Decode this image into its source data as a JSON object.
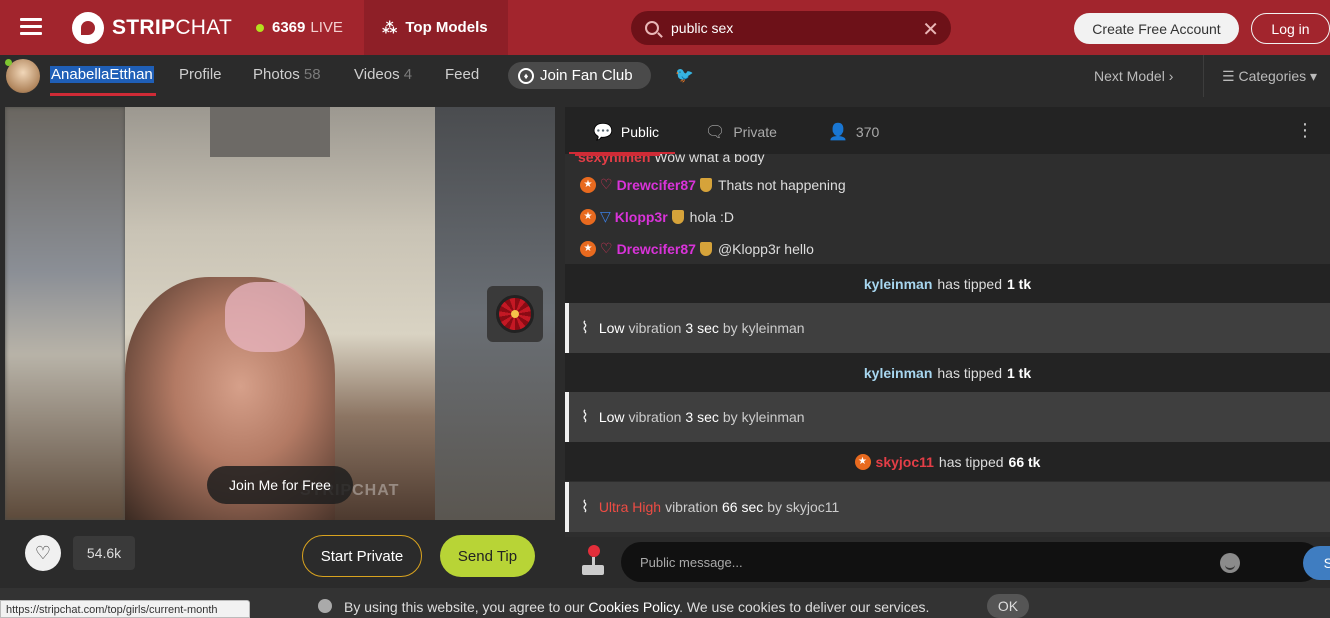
{
  "header": {
    "logo_bold": "STRIP",
    "logo_thin": "CHAT",
    "live_count": "6369",
    "live_label": "LIVE",
    "top_models": "Top Models",
    "search_value": "public sex",
    "create_account": "Create Free Account",
    "login": "Log in"
  },
  "model_nav": {
    "model_name": "AnabellaEtthan",
    "profile": "Profile",
    "photos": "Photos",
    "photos_count": "58",
    "videos": "Videos",
    "videos_count": "4",
    "feed": "Feed",
    "join_fan_club": "Join Fan Club",
    "next_model": "Next Model",
    "categories": "Categories"
  },
  "video": {
    "join_free": "Join Me for Free",
    "watermark": "STRIPCHAT",
    "likes": "54.6k",
    "start_private": "Start Private",
    "send_tip": "Send Tip"
  },
  "chat": {
    "tabs": {
      "public": "Public",
      "private": "Private",
      "users_count": "370"
    },
    "cut_message": {
      "user": "sexyhimen",
      "text": "Wow what a body"
    },
    "messages": [
      {
        "user": "Drewcifer87",
        "text": "Thats not happening",
        "user_color": "#d933d9"
      },
      {
        "user": "Klopp3r",
        "text": "hola :D",
        "user_color": "#d933d9"
      },
      {
        "user": "Drewcifer87",
        "text": "@Klopp3r hello",
        "user_color": "#d933d9"
      }
    ],
    "tip1": {
      "user": "kyleinman",
      "action": "has tipped",
      "amount": "1 tk"
    },
    "vib1": {
      "level": "Low",
      "word": "vibration",
      "duration": "3 sec",
      "by": "by kyleinman"
    },
    "tip2": {
      "user": "kyleinman",
      "action": "has tipped",
      "amount": "1 tk"
    },
    "vib2": {
      "level": "Low",
      "word": "vibration",
      "duration": "3 sec",
      "by": "by kyleinman"
    },
    "tip3": {
      "user": "skyjoc11",
      "action": "has tipped",
      "amount": "66 tk"
    },
    "vib3": {
      "level": "Ultra High",
      "word": "vibration",
      "duration": "66 sec",
      "by": "by skyjoc11"
    },
    "input_placeholder": "Public message...",
    "send": "Send"
  },
  "footer": {
    "status_url": "https://stripchat.com/top/girls/current-month",
    "cookie_text_1": "By using this website, you agree to our",
    "cookie_link": "Cookies Policy",
    "cookie_text_2": ". We use cookies to deliver our services.",
    "ok": "OK"
  }
}
